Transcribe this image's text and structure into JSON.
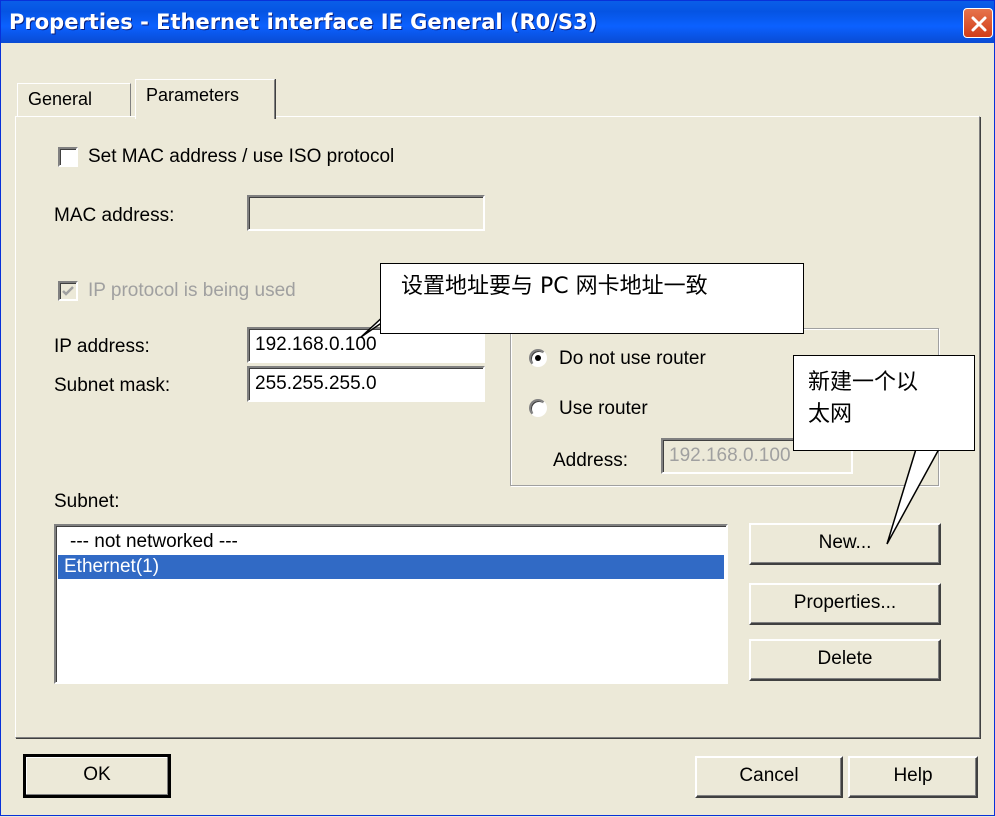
{
  "window": {
    "title": "Properties - Ethernet interface  IE General (R0/S3)"
  },
  "tabs": [
    {
      "label": "General",
      "active": false
    },
    {
      "label": "Parameters",
      "active": true
    }
  ],
  "params": {
    "set_mac_label": "Set MAC address / use ISO protocol",
    "set_mac_checked": false,
    "mac_label": "MAC address:",
    "mac_value": "",
    "ip_protocol_label": "IP protocol is being used",
    "ip_protocol_checked": true,
    "ip_label": "IP address:",
    "ip_value": "192.168.0.100",
    "subnet_label": "Subnet mask:",
    "subnet_value": "255.255.255.0"
  },
  "gateway": {
    "do_not_use_label": "Do not use router",
    "use_router_label": "Use router",
    "selected": "do_not_use",
    "address_label": "Address:",
    "address_value": "192.168.0.100"
  },
  "subnet": {
    "label": "Subnet:",
    "items": [
      {
        "label": "--- not networked ---",
        "selected": false
      },
      {
        "label": "Ethernet(1)",
        "selected": true
      }
    ]
  },
  "side_buttons": {
    "new": "New...",
    "properties": "Properties...",
    "delete": "Delete"
  },
  "footer": {
    "ok": "OK",
    "cancel": "Cancel",
    "help": "Help"
  },
  "callouts": {
    "address_note": "设置地址要与 PC 网卡地址一致",
    "new_note_line1": "新建一个以",
    "new_note_line2": "太网"
  },
  "colors": {
    "titlebar": "#0554e3",
    "selection": "#316ac5",
    "dialog_bg": "#ece9d8",
    "close_button": "#d23d1a"
  }
}
